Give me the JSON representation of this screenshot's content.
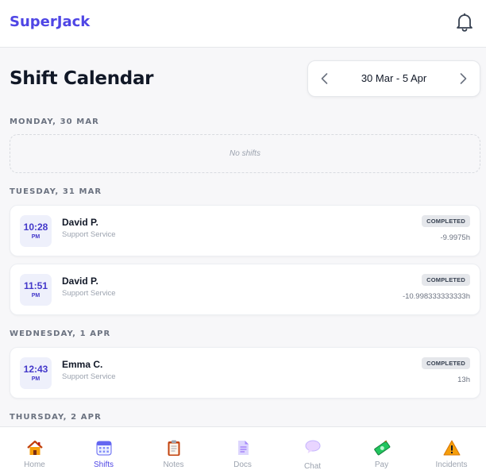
{
  "app": {
    "brand": "SuperJack"
  },
  "page": {
    "title": "Shift Calendar"
  },
  "range": {
    "label": "30 Mar - 5 Apr"
  },
  "days": [
    {
      "header": "MONDAY, 30 MAR",
      "empty_text": "No shifts"
    },
    {
      "header": "TUESDAY, 31 MAR"
    },
    {
      "header": "WEDNESDAY, 1 APR"
    },
    {
      "header": "THURSDAY, 2 APR"
    }
  ],
  "shifts": [
    {
      "time": "10:28",
      "ampm": "PM",
      "name": "David P.",
      "service": "Support Service",
      "status": "COMPLETED",
      "hours": "-9.9975h"
    },
    {
      "time": "11:51",
      "ampm": "PM",
      "name": "David P.",
      "service": "Support Service",
      "status": "COMPLETED",
      "hours": "-10.998333333333h"
    },
    {
      "time": "12:43",
      "ampm": "PM",
      "name": "Emma C.",
      "service": "Support Service",
      "status": "COMPLETED",
      "hours": "13h"
    }
  ],
  "nav": [
    {
      "label": "Home",
      "icon": "home-icon"
    },
    {
      "label": "Shifts",
      "icon": "calendar-icon",
      "active": true
    },
    {
      "label": "Notes",
      "icon": "clipboard-icon"
    },
    {
      "label": "Docs",
      "icon": "document-icon"
    },
    {
      "label": "Chat",
      "icon": "chat-bubble-icon"
    },
    {
      "label": "Pay",
      "icon": "money-icon"
    },
    {
      "label": "Incidents",
      "icon": "warning-icon"
    }
  ],
  "colors": {
    "accent": "#4f46e5",
    "time_badge_bg": "#eef0fb",
    "status_badge_bg": "#e5e7eb"
  }
}
